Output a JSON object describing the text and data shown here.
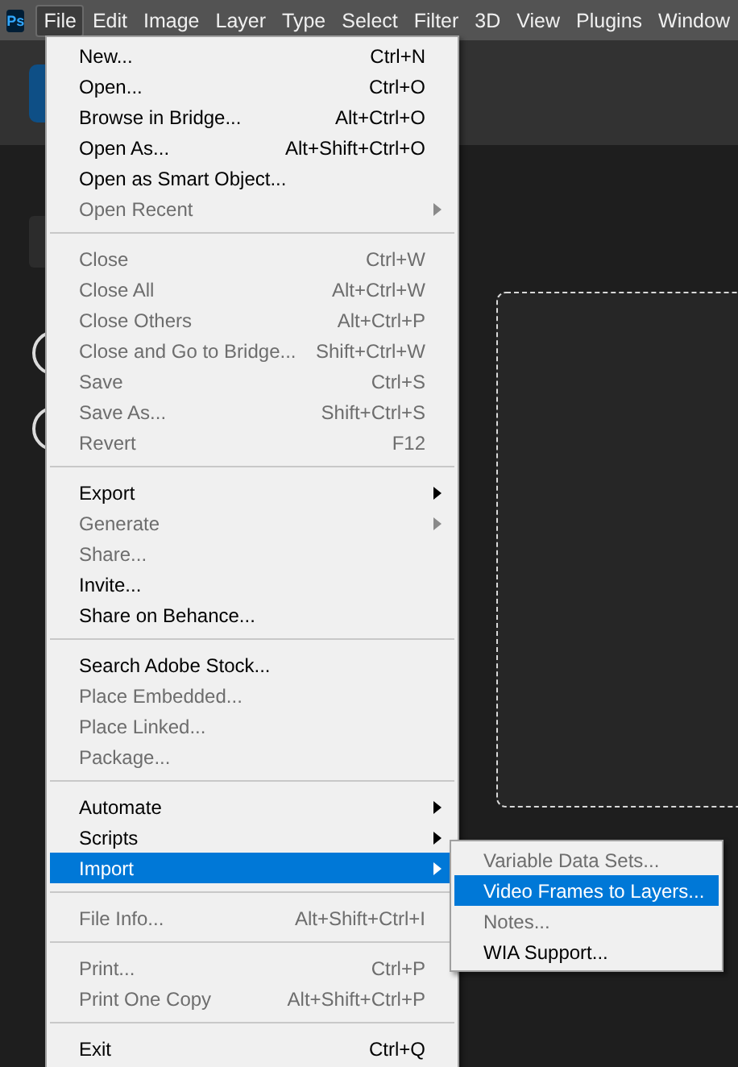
{
  "app": {
    "logo": "Ps"
  },
  "menubar": [
    {
      "label": "File",
      "selected": true
    },
    {
      "label": "Edit",
      "selected": false
    },
    {
      "label": "Image",
      "selected": false
    },
    {
      "label": "Layer",
      "selected": false
    },
    {
      "label": "Type",
      "selected": false
    },
    {
      "label": "Select",
      "selected": false
    },
    {
      "label": "Filter",
      "selected": false
    },
    {
      "label": "3D",
      "selected": false
    },
    {
      "label": "View",
      "selected": false
    },
    {
      "label": "Plugins",
      "selected": false
    },
    {
      "label": "Window",
      "selected": false
    }
  ],
  "file_menu": [
    [
      {
        "label": "New...",
        "shortcut": "Ctrl+N",
        "disabled": false,
        "submenu": false,
        "selected": false
      },
      {
        "label": "Open...",
        "shortcut": "Ctrl+O",
        "disabled": false,
        "submenu": false,
        "selected": false
      },
      {
        "label": "Browse in Bridge...",
        "shortcut": "Alt+Ctrl+O",
        "disabled": false,
        "submenu": false,
        "selected": false
      },
      {
        "label": "Open As...",
        "shortcut": "Alt+Shift+Ctrl+O",
        "disabled": false,
        "submenu": false,
        "selected": false
      },
      {
        "label": "Open as Smart Object...",
        "disabled": false,
        "submenu": false,
        "selected": false
      },
      {
        "label": "Open Recent",
        "disabled": true,
        "submenu": true,
        "selected": false
      }
    ],
    [
      {
        "label": "Close",
        "shortcut": "Ctrl+W",
        "disabled": true,
        "submenu": false,
        "selected": false
      },
      {
        "label": "Close All",
        "shortcut": "Alt+Ctrl+W",
        "disabled": true,
        "submenu": false,
        "selected": false
      },
      {
        "label": "Close Others",
        "shortcut": "Alt+Ctrl+P",
        "disabled": true,
        "submenu": false,
        "selected": false
      },
      {
        "label": "Close and Go to Bridge...",
        "shortcut": "Shift+Ctrl+W",
        "disabled": true,
        "submenu": false,
        "selected": false
      },
      {
        "label": "Save",
        "shortcut": "Ctrl+S",
        "disabled": true,
        "submenu": false,
        "selected": false
      },
      {
        "label": "Save As...",
        "shortcut": "Shift+Ctrl+S",
        "disabled": true,
        "submenu": false,
        "selected": false
      },
      {
        "label": "Revert",
        "shortcut": "F12",
        "disabled": true,
        "submenu": false,
        "selected": false
      }
    ],
    [
      {
        "label": "Export",
        "disabled": false,
        "submenu": true,
        "selected": false
      },
      {
        "label": "Generate",
        "disabled": true,
        "submenu": true,
        "selected": false
      },
      {
        "label": "Share...",
        "disabled": true,
        "submenu": false,
        "selected": false
      },
      {
        "label": "Invite...",
        "disabled": false,
        "submenu": false,
        "selected": false
      },
      {
        "label": "Share on Behance...",
        "disabled": false,
        "submenu": false,
        "selected": false
      }
    ],
    [
      {
        "label": "Search Adobe Stock...",
        "disabled": false,
        "submenu": false,
        "selected": false
      },
      {
        "label": "Place Embedded...",
        "disabled": true,
        "submenu": false,
        "selected": false
      },
      {
        "label": "Place Linked...",
        "disabled": true,
        "submenu": false,
        "selected": false
      },
      {
        "label": "Package...",
        "disabled": true,
        "submenu": false,
        "selected": false
      }
    ],
    [
      {
        "label": "Automate",
        "disabled": false,
        "submenu": true,
        "selected": false
      },
      {
        "label": "Scripts",
        "disabled": false,
        "submenu": true,
        "selected": false
      },
      {
        "label": "Import",
        "disabled": false,
        "submenu": true,
        "selected": true
      }
    ],
    [
      {
        "label": "File Info...",
        "shortcut": "Alt+Shift+Ctrl+I",
        "disabled": true,
        "submenu": false,
        "selected": false
      }
    ],
    [
      {
        "label": "Print...",
        "shortcut": "Ctrl+P",
        "disabled": true,
        "submenu": false,
        "selected": false
      },
      {
        "label": "Print One Copy",
        "shortcut": "Alt+Shift+Ctrl+P",
        "disabled": true,
        "submenu": false,
        "selected": false
      }
    ],
    [
      {
        "label": "Exit",
        "shortcut": "Ctrl+Q",
        "disabled": false,
        "submenu": false,
        "selected": false
      }
    ]
  ],
  "import_submenu": [
    {
      "label": "Variable Data Sets...",
      "disabled": true,
      "selected": false
    },
    {
      "label": "Video Frames to Layers...",
      "disabled": false,
      "selected": true
    },
    {
      "label": "Notes...",
      "disabled": true,
      "selected": false
    },
    {
      "label": "WIA Support...",
      "disabled": false,
      "selected": false
    }
  ]
}
